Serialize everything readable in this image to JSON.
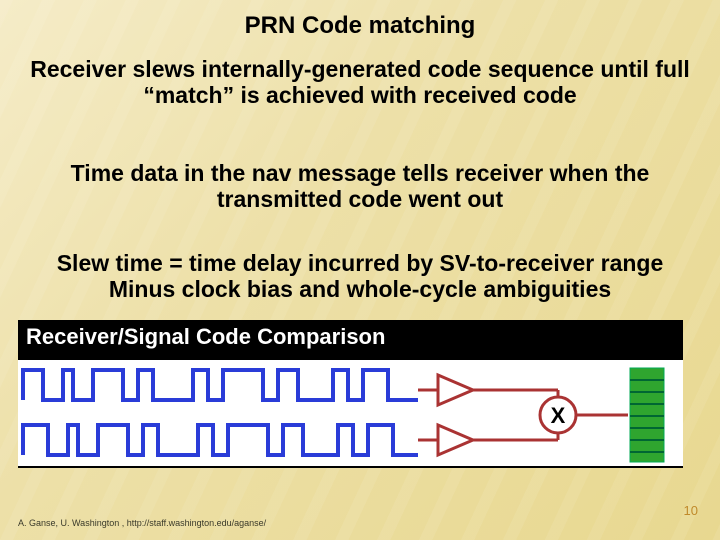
{
  "title": "PRN Code matching",
  "para1": "Receiver slews internally-generated code sequence until full “match” is achieved with received code",
  "para2": "Time data in the nav message tells receiver when the transmitted code went out",
  "para3": "Slew time = time delay incurred by SV-to-receiver range\nMinus clock bias and whole-cycle ambiguities",
  "overlay_label": "Receiver/Signal Code Comparison",
  "diagram": {
    "combiner_symbol": "X",
    "top_wave": "blue-square-code",
    "bottom_wave": "blue-square-code",
    "amps": 2,
    "output": "green-bar-stack"
  },
  "footer": "A. Ganse, U. Washington , http://staff.washington.edu/aganse/",
  "page_number": "10"
}
